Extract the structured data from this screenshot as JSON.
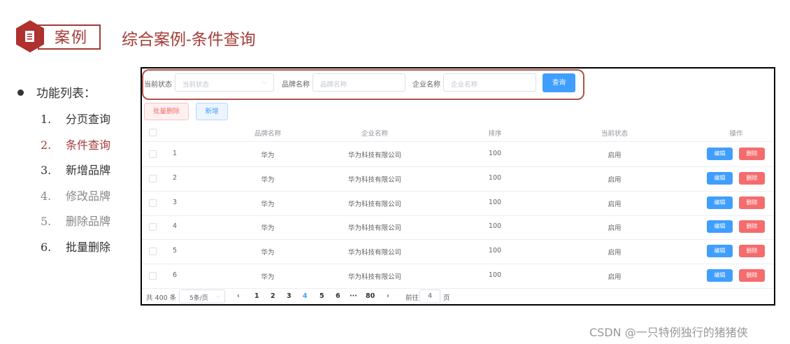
{
  "header": {
    "badge": "案例",
    "title": "综合案例-条件查询"
  },
  "features": {
    "title": "功能列表：",
    "items": [
      {
        "num": "1.",
        "label": "分页查询",
        "color": "#333333"
      },
      {
        "num": "2.",
        "label": "条件查询",
        "color": "#a33b37"
      },
      {
        "num": "3.",
        "label": "新增品牌",
        "color": "#333333"
      },
      {
        "num": "4.",
        "label": "修改品牌",
        "color": "#888888"
      },
      {
        "num": "5.",
        "label": "删除品牌",
        "color": "#888888"
      },
      {
        "num": "6.",
        "label": "批量删除",
        "color": "#333333"
      }
    ]
  },
  "search": {
    "status_label": "当前状态",
    "status_placeholder": "当前状态",
    "brand_label": "品牌名称",
    "brand_placeholder": "品牌名称",
    "company_label": "企业名称",
    "company_placeholder": "企业名称",
    "query_button": "查询"
  },
  "toolbar": {
    "batch_delete": "批量删除",
    "add": "新增"
  },
  "table": {
    "columns": [
      "品牌名称",
      "企业名称",
      "排序",
      "当前状态",
      "操作"
    ],
    "rows": [
      {
        "index": "1",
        "brand": "华为",
        "company": "华为科技有限公司",
        "sort": "100",
        "status": "启用"
      },
      {
        "index": "2",
        "brand": "华为",
        "company": "华为科技有限公司",
        "sort": "100",
        "status": "启用"
      },
      {
        "index": "3",
        "brand": "华为",
        "company": "华为科技有限公司",
        "sort": "100",
        "status": "启用"
      },
      {
        "index": "4",
        "brand": "华为",
        "company": "华为科技有限公司",
        "sort": "100",
        "status": "启用"
      },
      {
        "index": "5",
        "brand": "华为",
        "company": "华为科技有限公司",
        "sort": "100",
        "status": "启用"
      },
      {
        "index": "6",
        "brand": "华为",
        "company": "华为科技有限公司",
        "sort": "100",
        "status": "启用"
      }
    ],
    "edit_label": "编辑",
    "delete_label": "删除"
  },
  "pagination": {
    "total": "共 400 条",
    "page_size": "5条/页",
    "pages": [
      "1",
      "2",
      "3",
      "4",
      "5",
      "6",
      "···",
      "80"
    ],
    "current": "4",
    "goto_label": "前往",
    "goto_value": "4",
    "goto_unit": "页"
  },
  "watermark": "CSDN @一只特例独行的猪猪侠"
}
